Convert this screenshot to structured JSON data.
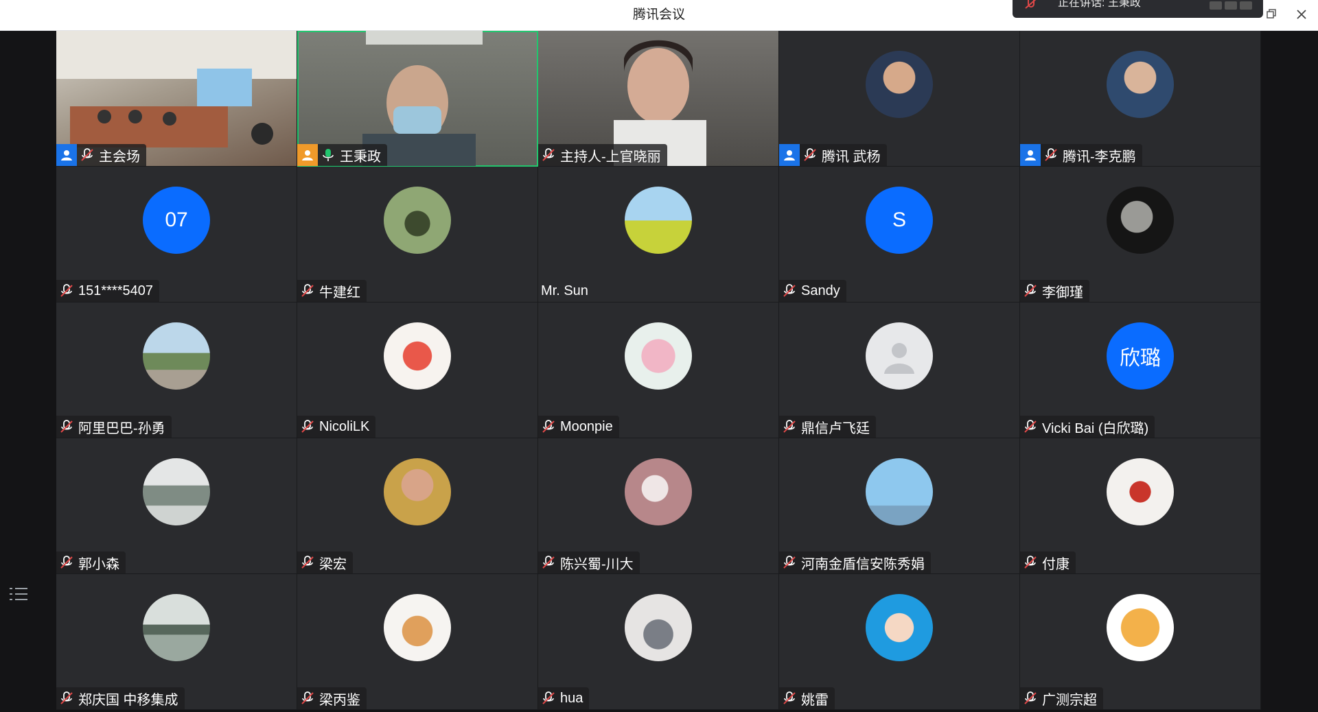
{
  "window": {
    "title": "腾讯会议",
    "speaking_text": "正在讲话: 王秉政"
  },
  "colors": {
    "avatar_blue": "#0a6cff",
    "active_speaker_border": "#22c56e",
    "host_badge": "#f09a2a",
    "member_badge": "#1a73e8"
  },
  "tiles": [
    {
      "name": "主会场",
      "kind": "video",
      "badge": "member",
      "mic": "muted"
    },
    {
      "name": "王秉政",
      "kind": "video",
      "badge": "host",
      "mic": "on",
      "active": true
    },
    {
      "name": "主持人-上官晓丽",
      "kind": "video",
      "badge": "none",
      "mic": "muted"
    },
    {
      "name": "腾讯 武杨",
      "kind": "photo",
      "badge": "member",
      "mic": "muted"
    },
    {
      "name": "腾讯-李克鹏",
      "kind": "photo",
      "badge": "member",
      "mic": "muted"
    },
    {
      "name": "151****5407",
      "kind": "initials",
      "avatar_text": "07",
      "mic": "muted"
    },
    {
      "name": "牛建红",
      "kind": "photo",
      "mic": "muted"
    },
    {
      "name": "Mr. Sun",
      "kind": "photo",
      "mic": "none"
    },
    {
      "name": "Sandy",
      "kind": "initials",
      "avatar_text": "S",
      "mic": "muted"
    },
    {
      "name": "李御瑾",
      "kind": "photo",
      "mic": "muted"
    },
    {
      "name": "阿里巴巴-孙勇",
      "kind": "photo",
      "mic": "muted"
    },
    {
      "name": "NicoliLK",
      "kind": "photo",
      "mic": "muted"
    },
    {
      "name": "Moonpie",
      "kind": "photo",
      "mic": "muted"
    },
    {
      "name": "鼎信卢飞廷",
      "kind": "default",
      "mic": "muted"
    },
    {
      "name": "Vicki Bai (白欣璐)",
      "kind": "initials",
      "avatar_text": "欣璐",
      "mic": "muted"
    },
    {
      "name": "郭小森",
      "kind": "photo",
      "mic": "muted"
    },
    {
      "name": "梁宏",
      "kind": "photo",
      "mic": "muted"
    },
    {
      "name": "陈兴蜀-川大",
      "kind": "photo",
      "mic": "muted"
    },
    {
      "name": "河南金盾信安陈秀娟",
      "kind": "photo",
      "mic": "muted"
    },
    {
      "name": "付康",
      "kind": "photo",
      "mic": "muted"
    },
    {
      "name": "郑庆国 中移集成",
      "kind": "photo",
      "mic": "muted"
    },
    {
      "name": "梁丙鉴",
      "kind": "photo",
      "mic": "muted"
    },
    {
      "name": "hua",
      "kind": "photo",
      "mic": "muted"
    },
    {
      "name": "姚雷",
      "kind": "photo",
      "mic": "muted"
    },
    {
      "name": "广测宗超",
      "kind": "photo",
      "mic": "muted"
    }
  ]
}
